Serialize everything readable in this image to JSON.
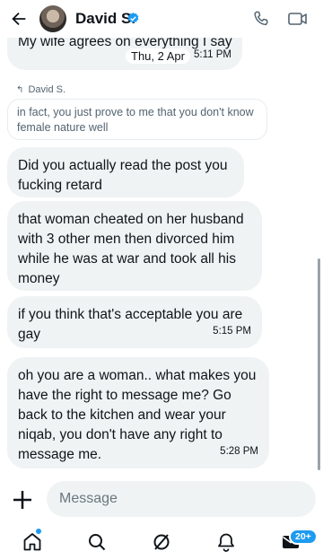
{
  "header": {
    "contact_name": "David S.",
    "verified": true
  },
  "messages": [
    {
      "text": "My wife agrees on everything I say",
      "date": "Thu, 2 Apr",
      "time": "5:11 PM"
    }
  ],
  "reply": {
    "label": "David S.",
    "quoted_text": "in fact, you just prove to me that you don't know female nature well"
  },
  "bubbles": [
    {
      "text": "Did you actually read the post you fucking retard"
    },
    {
      "text": "that woman cheated on her husband with 3 other men then divorced him while he was at war and took all his money"
    },
    {
      "text": "if you think that's acceptable you are gay",
      "time": "5:15 PM"
    },
    {
      "text": "oh you are a woman.. what makes you have the right to message me? Go back to the kitchen and wear your niqab, you don't have any right to message me.",
      "time": "5:28 PM"
    }
  ],
  "composer": {
    "placeholder": "Message"
  },
  "nav": {
    "messages_badge": "20+"
  },
  "colors": {
    "accent": "#1d9bf0",
    "bubble": "#eff3f4",
    "text": "#0f1419",
    "muted": "#536471"
  },
  "icons": [
    "back-arrow-icon",
    "verified-badge-icon",
    "phone-icon",
    "video-call-icon",
    "plus-icon",
    "home-icon",
    "search-icon",
    "grok-icon",
    "notifications-bell-icon",
    "messages-envelope-icon"
  ]
}
